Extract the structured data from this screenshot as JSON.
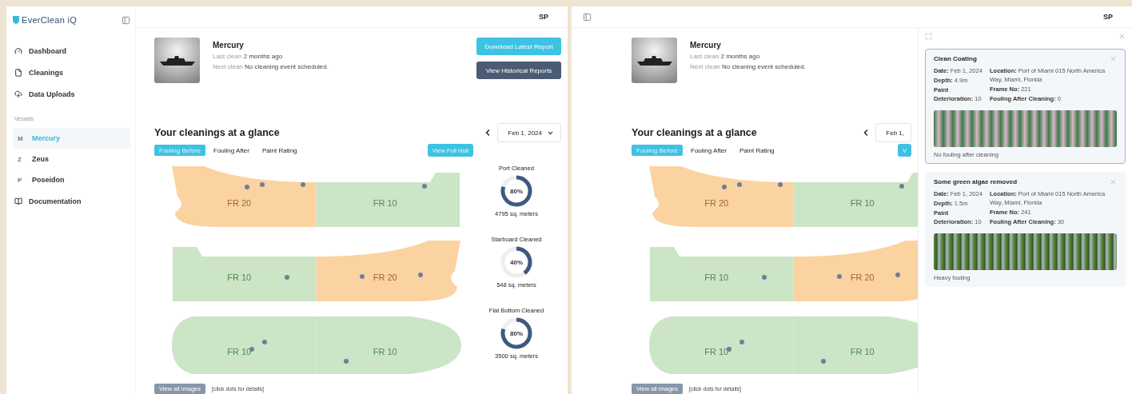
{
  "screens": [
    {
      "sidebar": {
        "open": true,
        "logo": "EverClean iQ",
        "nav": [
          {
            "kind": "dashboard",
            "label": "Dashboard"
          },
          {
            "kind": "cleanings",
            "label": "Cleanings"
          },
          {
            "kind": "uploads",
            "label": "Data Uploads"
          }
        ],
        "section_label": "Vessels",
        "vessels": [
          {
            "initial": "M",
            "name": "Mercury",
            "selected": true
          },
          {
            "initial": "Z",
            "name": "Zeus",
            "selected": false
          },
          {
            "initial": "P",
            "name": "Poseidon",
            "selected": false
          }
        ],
        "footer_nav": [
          {
            "kind": "docs",
            "label": "Documentation"
          }
        ]
      },
      "user_initials": "SP",
      "vessel": {
        "name": "Mercury",
        "last_clean_label": "Last clean",
        "last_clean": "2 months ago",
        "next_clean_label": "Next clean",
        "next_clean": "No cleaning event scheduled."
      },
      "actions": [
        {
          "kind": "primary",
          "label": "Download Latest Report"
        },
        {
          "kind": "secondary",
          "label": "View Historical Reports"
        }
      ],
      "glance": {
        "title": "Your cleanings at a glance",
        "date": "Feb 1, 2024",
        "tabs": [
          {
            "label": "Fouling Before",
            "selected": true
          },
          {
            "label": "Fouling After",
            "selected": false
          },
          {
            "label": "Paint Rating",
            "selected": false
          }
        ],
        "view_full_hull": "View Full Hull",
        "hulls": [
          {
            "kind": "port",
            "sections": [
              {
                "label": "FR 20",
                "color": "#fbd3a1"
              },
              {
                "label": "FR 10",
                "color": "#cbe5c6"
              }
            ]
          },
          {
            "kind": "starboard",
            "sections": [
              {
                "label": "FR 10",
                "color": "#cbe5c6"
              },
              {
                "label": "FR 20",
                "color": "#fbd3a1"
              }
            ]
          },
          {
            "kind": "bottom",
            "sections": [
              {
                "label": "FR 10",
                "color": "#cbe5c6"
              },
              {
                "label": "FR 10",
                "color": "#cbe5c6"
              }
            ]
          }
        ],
        "gauges": [
          {
            "title": "Port Cleaned",
            "reading": "80%",
            "level": 0.8,
            "area": "4795 sq. meters"
          },
          {
            "title": "Starboard Cleaned",
            "reading": "40%",
            "level": 0.4,
            "area": "548 sq. meters"
          },
          {
            "title": "Flat Bottom Cleaned",
            "reading": "80%",
            "level": 0.8,
            "area": "3500 sq. meters"
          }
        ],
        "view_all_images": "View all images",
        "hint": "[click dots for details]"
      }
    },
    {
      "sidebar": {
        "open": false
      },
      "user_initials": "SP",
      "vessel": {
        "name": "Mercury",
        "last_clean_label": "Last clean",
        "last_clean": "2 months ago",
        "next_clean_label": "Next clean",
        "next_clean": "No cleaning event scheduled."
      },
      "glance": {
        "title": "Your cleanings at a glance",
        "date": "Feb 1,",
        "tabs": [
          {
            "label": "Fouling Before",
            "selected": true
          },
          {
            "label": "Fouling After",
            "selected": false
          },
          {
            "label": "Paint Rating",
            "selected": false
          }
        ],
        "view_full_hull": "V",
        "hulls": [
          {
            "kind": "port",
            "sections": [
              {
                "label": "FR 20",
                "color": "#fbd3a1"
              },
              {
                "label": "FR 10",
                "color": "#cbe5c6"
              }
            ]
          },
          {
            "kind": "starboard",
            "sections": [
              {
                "label": "FR 10",
                "color": "#cbe5c6"
              },
              {
                "label": "FR 20",
                "color": "#fbd3a1"
              }
            ]
          },
          {
            "kind": "bottom",
            "sections": [
              {
                "label": "FR 10",
                "color": "#cbe5c6"
              },
              {
                "label": "FR 10",
                "color": "#cbe5c6"
              }
            ]
          }
        ],
        "view_all_images": "View all images",
        "hint": "[click dots for details]"
      },
      "details_panel": {
        "cards": [
          {
            "title": "Clean Coating",
            "selected": true,
            "left": [
              "**Date:** Feb 1, 2024",
              "**Depth:** 4.9m",
              "**Paint Deterioration:** 10"
            ],
            "right": [
              "**Location:** Port of Miami 015 North America Way, Miami, Florida",
              "**Frame No:** 221",
              "**Fouling After Cleaning:** 0"
            ],
            "photo": {
              "kind": "stripes"
            },
            "caption": "No fouling after cleaning"
          },
          {
            "title": "Some green algae removed",
            "selected": false,
            "left": [
              "**Date:** Feb 1, 2024",
              "**Depth:** 1.5m",
              "**Paint Deterioration:** 10"
            ],
            "right": [
              "**Location:** Port of Miami 015 North America Way, Miami, Florida",
              "**Frame No:** 241",
              "**Fouling After Cleaning:** 30"
            ],
            "photo": {
              "kind": "algae"
            },
            "caption": "Heavy fouling"
          }
        ]
      }
    }
  ]
}
